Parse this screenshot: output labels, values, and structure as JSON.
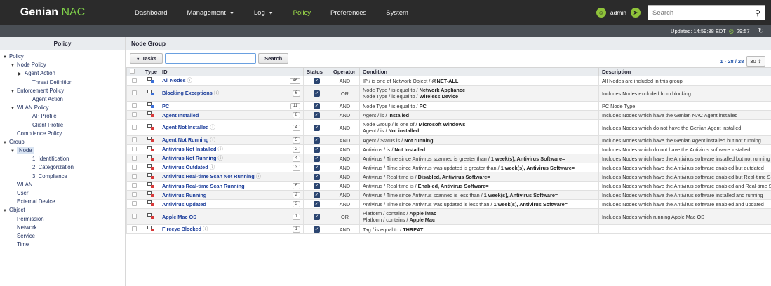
{
  "logo": {
    "brand": "Genian",
    "product": "NAC"
  },
  "nav": [
    {
      "label": "Dashboard",
      "caret": false,
      "active": false
    },
    {
      "label": "Management",
      "caret": true,
      "active": false
    },
    {
      "label": "Log",
      "caret": true,
      "active": false
    },
    {
      "label": "Policy",
      "caret": false,
      "active": true
    },
    {
      "label": "Preferences",
      "caret": false,
      "active": false
    },
    {
      "label": "System",
      "caret": false,
      "active": false
    }
  ],
  "user": {
    "name": "admin"
  },
  "search": {
    "placeholder": "Search"
  },
  "status": {
    "updated": "Updated: 14:59:38 EDT",
    "timer": "29:57"
  },
  "sidebar": {
    "title": "Policy",
    "items": [
      {
        "label": "Policy",
        "level": 0,
        "toggle": "open"
      },
      {
        "label": "Node Policy",
        "level": 1,
        "toggle": "open"
      },
      {
        "label": "Agent Action",
        "level": 2,
        "toggle": "closed"
      },
      {
        "label": "Threat Definition",
        "level": 3,
        "toggle": ""
      },
      {
        "label": "Enforcement Policy",
        "level": 1,
        "toggle": "open"
      },
      {
        "label": "Agent Action",
        "level": 3,
        "toggle": ""
      },
      {
        "label": "WLAN Policy",
        "level": 1,
        "toggle": "open"
      },
      {
        "label": "AP Profile",
        "level": 3,
        "toggle": ""
      },
      {
        "label": "Client Profile",
        "level": 3,
        "toggle": ""
      },
      {
        "label": "Compliance Policy",
        "level": 1,
        "toggle": ""
      },
      {
        "label": "Group",
        "level": 0,
        "toggle": "open"
      },
      {
        "label": "Node",
        "level": 1,
        "toggle": "open",
        "selected": true
      },
      {
        "label": "1. Identification",
        "level": 3,
        "toggle": ""
      },
      {
        "label": "2. Categorization",
        "level": 3,
        "toggle": ""
      },
      {
        "label": "3. Compliance",
        "level": 3,
        "toggle": ""
      },
      {
        "label": "WLAN",
        "level": 1,
        "toggle": ""
      },
      {
        "label": "User",
        "level": 1,
        "toggle": ""
      },
      {
        "label": "External Device",
        "level": 1,
        "toggle": ""
      },
      {
        "label": "Object",
        "level": 0,
        "toggle": "open"
      },
      {
        "label": "Permission",
        "level": 1,
        "toggle": ""
      },
      {
        "label": "Network",
        "level": 1,
        "toggle": ""
      },
      {
        "label": "Service",
        "level": 1,
        "toggle": ""
      },
      {
        "label": "Time",
        "level": 1,
        "toggle": ""
      }
    ]
  },
  "main": {
    "title": "Node Group",
    "tasks_label": "Tasks",
    "search_label": "Search",
    "pager": {
      "count": "1 - 28 / 28",
      "per_page": "30"
    },
    "columns": [
      "Type",
      "ID",
      "Status",
      "Operator",
      "Condition",
      "Description"
    ],
    "rows": [
      {
        "type": "blue",
        "id": "All Nodes",
        "info": true,
        "count": "46",
        "op": "AND",
        "cond": [
          [
            "IP / is one of Network Object / ",
            "@NET-ALL"
          ]
        ],
        "desc": "All Nodes are included in this group",
        "h": 13
      },
      {
        "type": "blue",
        "id": "Blocking Exceptions",
        "info": true,
        "count": "6",
        "op": "OR",
        "cond": [
          [
            "Node Type / is equal to / ",
            "Network Appliance"
          ],
          [
            "Node Type / is equal to / ",
            "Wireless Device"
          ]
        ],
        "desc": "Includes Nodes excluded from blocking",
        "h": 23
      },
      {
        "type": "blue",
        "id": "PC",
        "info": false,
        "count": "11",
        "op": "AND",
        "cond": [
          [
            "Node Type / is equal to / ",
            "PC"
          ]
        ],
        "desc": "PC Node Type",
        "h": 13
      },
      {
        "type": "red",
        "id": "Agent Installed",
        "info": false,
        "count": "8",
        "op": "AND",
        "cond": [
          [
            "Agent / is / ",
            "Installed"
          ]
        ],
        "desc": "Includes Nodes which have the Genian NAC Agent installed",
        "h": 13
      },
      {
        "type": "red",
        "id": "Agent Not Installed",
        "info": true,
        "count": "4",
        "op": "AND",
        "cond": [
          [
            "Node Group / is one of / ",
            "Microsoft Windows"
          ],
          [
            "Agent / is / ",
            "Not installed"
          ]
        ],
        "desc": "Includes Nodes which do not have the Genian Agent installed",
        "h": 23
      },
      {
        "type": "red",
        "id": "Agent Not Running",
        "info": true,
        "count": "5",
        "op": "AND",
        "cond": [
          [
            "Agent / Status is / ",
            "Not running"
          ]
        ],
        "desc": "Includes Nodes which have the Genian Agent installed but not running",
        "h": 13
      },
      {
        "type": "red",
        "id": "Antivirus Not Installed",
        "info": true,
        "count": "2",
        "op": "AND",
        "cond": [
          [
            "Antivirus / is / ",
            "Not Installed"
          ]
        ],
        "desc": "Includes Nodes which do not have the Antivirus software installed",
        "h": 13
      },
      {
        "type": "red",
        "id": "Antivirus Not Running",
        "info": true,
        "count": "4",
        "op": "AND",
        "cond": [
          [
            "Antivirus / Time since Antivirus scanned is greater than / ",
            "1 week(s), Antivirus Software="
          ]
        ],
        "desc": "Includes Nodes which have the Antivirus software installed but not running",
        "h": 13
      },
      {
        "type": "red",
        "id": "Antivirus Outdated",
        "info": true,
        "count": "3",
        "op": "AND",
        "cond": [
          [
            "Antivirus / Time since Antivirus was updated is greater than / ",
            "1 week(s), Antivirus Software="
          ]
        ],
        "desc": "Includes Nodes which have the Antivirus software enabled but outdated",
        "h": 13
      },
      {
        "type": "red",
        "id": "Antivirus Real-time Scan Not Running",
        "info": true,
        "count": "",
        "op": "AND",
        "cond": [
          [
            "Antivirus / Real-time is / ",
            "Disabled, Antivirus Software="
          ]
        ],
        "desc": "Includes Nodes which have the Antivirus software enabled but Real-time S",
        "h": 13
      },
      {
        "type": "red",
        "id": "Antivirus Real-time Scan Running",
        "info": false,
        "count": "6",
        "op": "AND",
        "cond": [
          [
            "Antivirus / Real-time is / ",
            "Enabled, Antivirus Software="
          ]
        ],
        "desc": "Includes Nodes which have the Antivirus software enabled and Real-time S",
        "h": 13
      },
      {
        "type": "red",
        "id": "Antivirus Running",
        "info": false,
        "count": "2",
        "op": "AND",
        "cond": [
          [
            "Antivirus / Time since Antivirus scanned is less than / ",
            "1 week(s), Antivirus Software="
          ]
        ],
        "desc": "Includes Nodes which have the Antivirus software installed and running",
        "h": 13
      },
      {
        "type": "red",
        "id": "Antivirus Updated",
        "info": false,
        "count": "3",
        "op": "AND",
        "cond": [
          [
            "Antivirus / Time since Antivirus was updated is less than / ",
            "1 week(s), Antivirus Software="
          ]
        ],
        "desc": "Includes Nodes which have the Antivirus software enabled and updated",
        "h": 13
      },
      {
        "type": "red",
        "id": "Apple Mac OS",
        "info": false,
        "count": "1",
        "op": "OR",
        "cond": [
          [
            "Platform / contains / ",
            "Apple iMac"
          ],
          [
            "Platform / contains / ",
            "Apple Mac"
          ]
        ],
        "desc": "Includes Nodes which running Apple Mac OS",
        "h": 23
      },
      {
        "type": "red",
        "id": "Fireeye Blocked",
        "info": true,
        "count": "1",
        "op": "AND",
        "cond": [
          [
            "Tag / is equal to / ",
            "THREAT"
          ]
        ],
        "desc": "",
        "h": 13
      }
    ]
  }
}
